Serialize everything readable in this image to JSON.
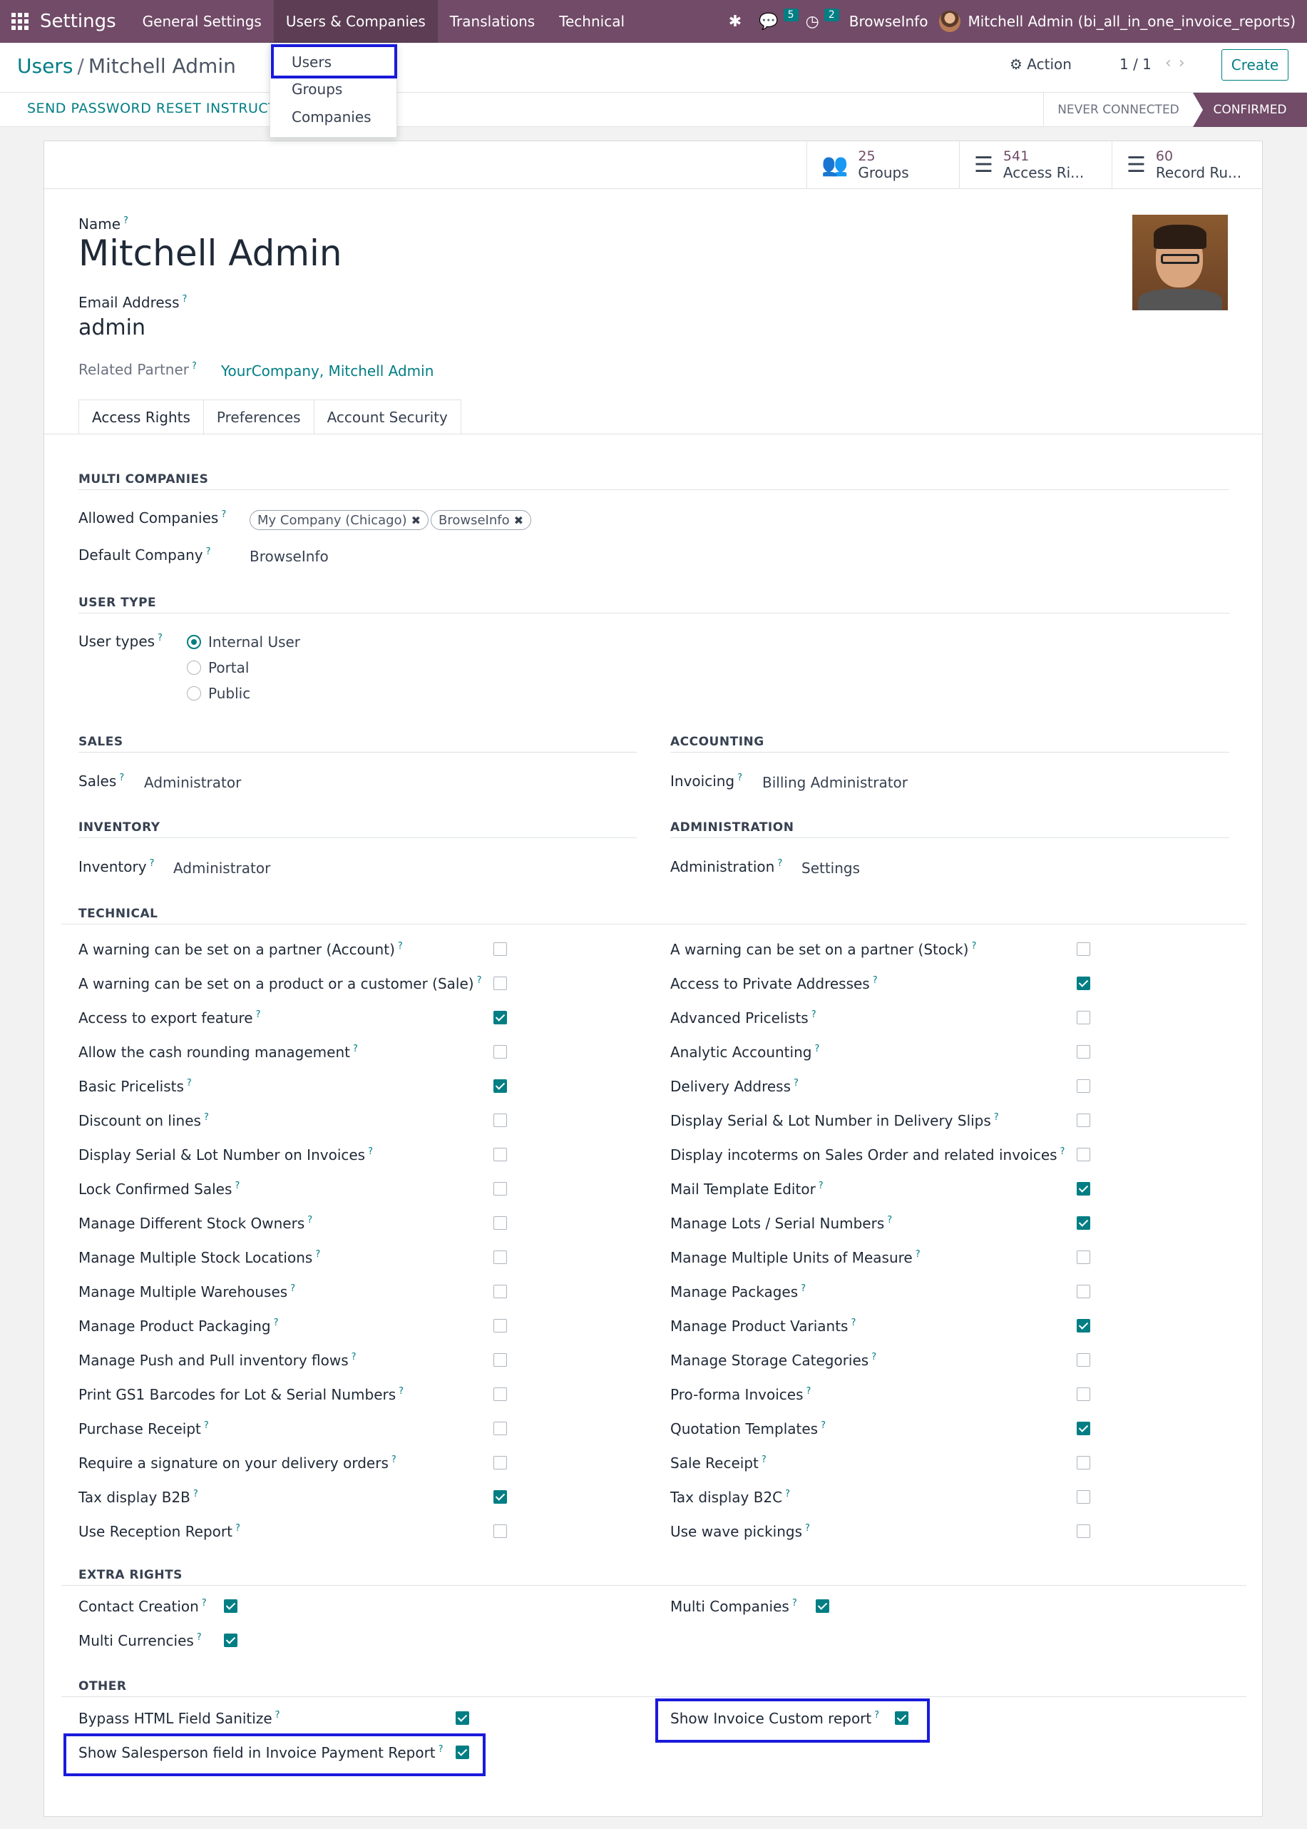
{
  "topbar": {
    "app_name": "Settings",
    "menu": [
      "General Settings",
      "Users & Companies",
      "Translations",
      "Technical"
    ],
    "messages_count": "5",
    "activities_count": "2",
    "company": "BrowseInfo",
    "user": "Mitchell Admin (bi_all_in_one_invoice_reports)"
  },
  "dropdown": [
    "Users",
    "Groups",
    "Companies"
  ],
  "breadcrumb": {
    "parent": "Users",
    "current": "Mitchell Admin"
  },
  "control": {
    "action": "Action",
    "pager": "1 / 1",
    "create": "Create"
  },
  "status": {
    "reset": "SEND PASSWORD RESET INSTRUCT",
    "never": "NEVER CONNECTED",
    "confirmed": "CONFIRMED"
  },
  "smart_buttons": [
    {
      "num": "25",
      "label": "Groups"
    },
    {
      "num": "541",
      "label": "Access Ri..."
    },
    {
      "num": "60",
      "label": "Record Ru..."
    }
  ],
  "form": {
    "name_label": "Name",
    "name": "Mitchell Admin",
    "email_label": "Email Address",
    "email": "admin",
    "partner_label": "Related Partner",
    "partner": "YourCompany, Mitchell Admin"
  },
  "tabs": [
    "Access Rights",
    "Preferences",
    "Account Security"
  ],
  "multi_companies": {
    "title": "MULTI COMPANIES",
    "allowed_label": "Allowed Companies",
    "allowed": [
      "My Company (Chicago)",
      "BrowseInfo"
    ],
    "default_label": "Default Company",
    "default": "BrowseInfo"
  },
  "user_type": {
    "title": "USER TYPE",
    "label": "User types",
    "options": [
      "Internal User",
      "Portal",
      "Public"
    ],
    "selected": "Internal User"
  },
  "apps": {
    "sales_title": "SALES",
    "sales_label": "Sales",
    "sales_value": "Administrator",
    "accounting_title": "ACCOUNTING",
    "invoicing_label": "Invoicing",
    "invoicing_value": "Billing Administrator",
    "inventory_title": "INVENTORY",
    "inventory_label": "Inventory",
    "inventory_value": "Administrator",
    "admin_title": "ADMINISTRATION",
    "admin_label": "Administration",
    "admin_value": "Settings"
  },
  "technical": {
    "title": "TECHNICAL",
    "left": [
      {
        "label": "A warning can be set on a partner (Account)",
        "checked": false
      },
      {
        "label": "A warning can be set on a product or a customer (Sale)",
        "checked": false
      },
      {
        "label": "Access to export feature",
        "checked": true
      },
      {
        "label": "Allow the cash rounding management",
        "checked": false
      },
      {
        "label": "Basic Pricelists",
        "checked": true
      },
      {
        "label": "Discount on lines",
        "checked": false
      },
      {
        "label": "Display Serial & Lot Number on Invoices",
        "checked": false
      },
      {
        "label": "Lock Confirmed Sales",
        "checked": false
      },
      {
        "label": "Manage Different Stock Owners",
        "checked": false
      },
      {
        "label": "Manage Multiple Stock Locations",
        "checked": false
      },
      {
        "label": "Manage Multiple Warehouses",
        "checked": false
      },
      {
        "label": "Manage Product Packaging",
        "checked": false
      },
      {
        "label": "Manage Push and Pull inventory flows",
        "checked": false
      },
      {
        "label": "Print GS1 Barcodes for Lot & Serial Numbers",
        "checked": false
      },
      {
        "label": "Purchase Receipt",
        "checked": false
      },
      {
        "label": "Require a signature on your delivery orders",
        "checked": false
      },
      {
        "label": "Tax display B2B",
        "checked": true
      },
      {
        "label": "Use Reception Report",
        "checked": false
      }
    ],
    "right": [
      {
        "label": "A warning can be set on a partner (Stock)",
        "checked": false
      },
      {
        "label": "Access to Private Addresses",
        "checked": true
      },
      {
        "label": "Advanced Pricelists",
        "checked": false
      },
      {
        "label": "Analytic Accounting",
        "checked": false
      },
      {
        "label": "Delivery Address",
        "checked": false
      },
      {
        "label": "Display Serial & Lot Number in Delivery Slips",
        "checked": false
      },
      {
        "label": "Display incoterms on Sales Order and related invoices",
        "checked": false
      },
      {
        "label": "Mail Template Editor",
        "checked": true
      },
      {
        "label": "Manage Lots / Serial Numbers",
        "checked": true
      },
      {
        "label": "Manage Multiple Units of Measure",
        "checked": false
      },
      {
        "label": "Manage Packages",
        "checked": false
      },
      {
        "label": "Manage Product Variants",
        "checked": true
      },
      {
        "label": "Manage Storage Categories",
        "checked": false
      },
      {
        "label": "Pro-forma Invoices",
        "checked": false
      },
      {
        "label": "Quotation Templates",
        "checked": true
      },
      {
        "label": "Sale Receipt",
        "checked": false
      },
      {
        "label": "Tax display B2C",
        "checked": false
      },
      {
        "label": "Use wave pickings",
        "checked": false
      }
    ]
  },
  "extra_rights": {
    "title": "EXTRA RIGHTS",
    "items": [
      {
        "label": "Contact Creation",
        "checked": true
      },
      {
        "label": "Multi Currencies",
        "checked": true
      },
      {
        "label": "Multi Companies",
        "checked": true
      }
    ]
  },
  "other": {
    "title": "OTHER",
    "items": [
      {
        "label": "Bypass HTML Field Sanitize",
        "checked": true
      },
      {
        "label": "Show Salesperson field in Invoice Payment Report",
        "checked": true
      },
      {
        "label": "Show Invoice Custom report",
        "checked": true
      }
    ]
  },
  "colors": {
    "brand": "#714b67",
    "accent": "#017e84",
    "highlight": "#1a1adb"
  }
}
